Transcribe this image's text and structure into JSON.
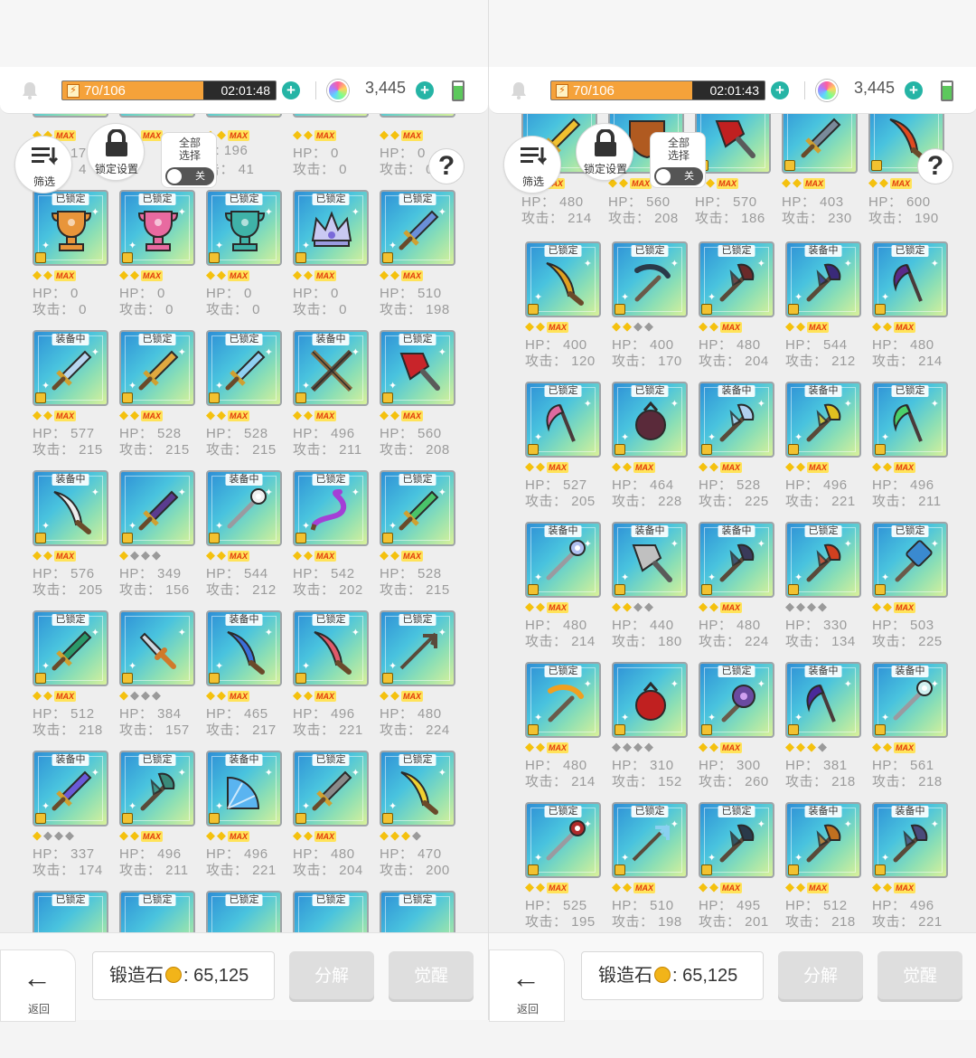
{
  "status": {
    "stamina_text": "70/106",
    "stamina_fraction": 0.66
  },
  "panels": [
    {
      "id": "left",
      "timer": "02:01:48",
      "gems": "3,445",
      "offset": 0,
      "partial_top": [
        {
          "hp": "17",
          "atk": "4"
        },
        {
          "hp": "",
          "atk": ""
        },
        {
          "hp": "196",
          "atk": "41",
          "hpPrefix": "P:",
          "atkPrefix": "击："
        },
        {
          "hp": "0",
          "atk": "0"
        },
        {
          "hp": "0",
          "atk": "0"
        }
      ]
    },
    {
      "id": "right",
      "timer": "02:01:43",
      "gems": "3,445",
      "offset": 0
    }
  ],
  "labels": {
    "hp": "HP：",
    "atk": "攻击：",
    "locked": "已锁定",
    "equipped": "装备中",
    "max": "MAX",
    "filter": "筛选",
    "lock_settings": "锁定设置",
    "select_all": "全部\n选择",
    "toggle_off": "关",
    "help": "?",
    "back": "返回",
    "stone_label": "锻造石",
    "stone_value": "65,125",
    "decompose": "分解",
    "awaken": "觉醒"
  },
  "left_items": [
    {
      "badge": "已锁定",
      "rank": "max",
      "hp": "0",
      "atk": "0",
      "color": "#e8953a",
      "shape": "trophy"
    },
    {
      "badge": "已锁定",
      "rank": "max",
      "hp": "0",
      "atk": "0",
      "color": "#e86aa0",
      "shape": "trophy"
    },
    {
      "badge": "已锁定",
      "rank": "max",
      "hp": "0",
      "atk": "0",
      "color": "#3fb2a8",
      "shape": "trophy"
    },
    {
      "badge": "已锁定",
      "rank": "max",
      "hp": "0",
      "atk": "0",
      "color": "#c9c9f2",
      "shape": "crown"
    },
    {
      "badge": "已锁定",
      "rank": "max",
      "hp": "510",
      "atk": "198",
      "color": "#6a8fd9",
      "shape": "sword"
    },
    {
      "badge": "装备中",
      "rank": "max",
      "hp": "577",
      "atk": "215",
      "color": "#b8d6f0",
      "shape": "sword"
    },
    {
      "badge": "已锁定",
      "rank": "max",
      "hp": "528",
      "atk": "215",
      "color": "#e0a940",
      "shape": "sword"
    },
    {
      "badge": "已锁定",
      "rank": "max",
      "hp": "528",
      "atk": "215",
      "color": "#8fd0f2",
      "shape": "sword"
    },
    {
      "badge": "装备中",
      "rank": "max",
      "hp": "496",
      "atk": "211",
      "color": "#8a6a3f",
      "shape": "crossed"
    },
    {
      "badge": "已锁定",
      "rank": "max",
      "hp": "560",
      "atk": "208",
      "color": "#c8242a",
      "shape": "cleaver"
    },
    {
      "badge": "装备中",
      "rank": "max",
      "hp": "576",
      "atk": "205",
      "color": "#ececec",
      "shape": "scimitar"
    },
    {
      "badge": "",
      "rank": "1g3s",
      "hp": "349",
      "atk": "156",
      "color": "#5a3c8f",
      "shape": "sword"
    },
    {
      "badge": "装备中",
      "rank": "max",
      "hp": "544",
      "atk": "212",
      "color": "#f0f0f0",
      "shape": "staff"
    },
    {
      "badge": "已锁定",
      "rank": "max",
      "hp": "542",
      "atk": "202",
      "color": "#a43fd6",
      "shape": "whip"
    },
    {
      "badge": "已锁定",
      "rank": "max",
      "hp": "528",
      "atk": "215",
      "color": "#49c46a",
      "shape": "sword"
    },
    {
      "badge": "已锁定",
      "rank": "max",
      "hp": "512",
      "atk": "218",
      "color": "#2a9a6a",
      "shape": "sword"
    },
    {
      "badge": "",
      "rank": "1g3s",
      "hp": "384",
      "atk": "157",
      "color": "#d07a2a",
      "shape": "dagger"
    },
    {
      "badge": "装备中",
      "rank": "max",
      "hp": "465",
      "atk": "217",
      "color": "#3a6fd9",
      "shape": "scimitar"
    },
    {
      "badge": "已锁定",
      "rank": "max",
      "hp": "496",
      "atk": "221",
      "color": "#e05a6a",
      "shape": "scimitar"
    },
    {
      "badge": "已锁定",
      "rank": "max",
      "hp": "480",
      "atk": "224",
      "color": "#5a4a3a",
      "shape": "trident"
    },
    {
      "badge": "装备中",
      "rank": "1g3s",
      "hp": "337",
      "atk": "174",
      "color": "#6a5ad9",
      "shape": "sword"
    },
    {
      "badge": "已锁定",
      "rank": "max",
      "hp": "496",
      "atk": "211",
      "color": "#3a8a7a",
      "shape": "axe"
    },
    {
      "badge": "装备中",
      "rank": "max",
      "hp": "496",
      "atk": "221",
      "color": "#5ab4f0",
      "shape": "fan"
    },
    {
      "badge": "已锁定",
      "rank": "max",
      "hp": "480",
      "atk": "204",
      "color": "#8a8a8a",
      "shape": "sword"
    },
    {
      "badge": "已锁定",
      "rank": "3g1s",
      "hp": "470",
      "atk": "200",
      "color": "#f0d030",
      "shape": "scimitar"
    }
  ],
  "left_bottom_badges": [
    "已锁定",
    "已锁定",
    "已锁定",
    "已锁定",
    "已锁定"
  ],
  "right_top_stats": [
    {
      "hp": "480",
      "atk": "214",
      "color": "#f0c030",
      "shape": "sword"
    },
    {
      "hp": "560",
      "atk": "208",
      "color": "#b05a20",
      "shape": "shield"
    },
    {
      "hp": "570",
      "atk": "186",
      "color": "#c02020",
      "shape": "cleaver"
    },
    {
      "hp": "403",
      "atk": "230",
      "color": "#7a8a9a",
      "shape": "sword"
    },
    {
      "hp": "600",
      "atk": "190",
      "color": "#e04a20",
      "shape": "scimitar"
    }
  ],
  "right_items": [
    {
      "badge": "已锁定",
      "rank": "max",
      "hp": "400",
      "atk": "120",
      "color": "#e0a020",
      "shape": "scimitar"
    },
    {
      "badge": "已锁定",
      "rank": "2g2s",
      "hp": "400",
      "atk": "170",
      "color": "#2a3a4a",
      "shape": "pick"
    },
    {
      "badge": "已锁定",
      "rank": "max",
      "hp": "480",
      "atk": "204",
      "color": "#6a2a2a",
      "shape": "axe"
    },
    {
      "badge": "装备中",
      "rank": "max",
      "hp": "544",
      "atk": "212",
      "color": "#3a2a7a",
      "shape": "axe"
    },
    {
      "badge": "已锁定",
      "rank": "max",
      "hp": "480",
      "atk": "214",
      "color": "#5a2a8a",
      "shape": "scythe"
    },
    {
      "badge": "已锁定",
      "rank": "max",
      "hp": "527",
      "atk": "205",
      "color": "#e06aa0",
      "shape": "scythe"
    },
    {
      "badge": "已锁定",
      "rank": "max",
      "hp": "464",
      "atk": "228",
      "color": "#5a2a3a",
      "shape": "bag"
    },
    {
      "badge": "装备中",
      "rank": "max",
      "hp": "528",
      "atk": "225",
      "color": "#b0d0f0",
      "shape": "axe"
    },
    {
      "badge": "装备中",
      "rank": "max",
      "hp": "496",
      "atk": "221",
      "color": "#e0c020",
      "shape": "axe"
    },
    {
      "badge": "已锁定",
      "rank": "max",
      "hp": "496",
      "atk": "211",
      "color": "#4ad06a",
      "shape": "scythe"
    },
    {
      "badge": "装备中",
      "rank": "max",
      "hp": "480",
      "atk": "214",
      "color": "#b0c0f0",
      "shape": "staff"
    },
    {
      "badge": "装备中",
      "rank": "2g2s",
      "hp": "440",
      "atk": "180",
      "color": "#c0c0c0",
      "shape": "cleaver"
    },
    {
      "badge": "装备中",
      "rank": "max",
      "hp": "480",
      "atk": "224",
      "color": "#3a3a5a",
      "shape": "axe"
    },
    {
      "badge": "已锁定",
      "rank": "max",
      "hp": "330",
      "atk": "134",
      "color": "#d04020",
      "shape": "axe",
      "rankOverride": "4s"
    },
    {
      "badge": "已锁定",
      "rank": "max",
      "hp": "503",
      "atk": "225",
      "color": "#3a8ad0",
      "shape": "hammer"
    },
    {
      "badge": "已锁定",
      "rank": "max",
      "hp": "480",
      "atk": "214",
      "color": "#f0a020",
      "shape": "pick"
    },
    {
      "badge": "",
      "rank": "4s",
      "hp": "310",
      "atk": "152",
      "color": "#c02020",
      "shape": "bag"
    },
    {
      "badge": "已锁定",
      "rank": "max",
      "hp": "300",
      "atk": "260",
      "color": "#6a4aa0",
      "shape": "mace"
    },
    {
      "badge": "装备中",
      "rank": "3g1s",
      "hp": "381",
      "atk": "218",
      "color": "#4a2a9a",
      "shape": "scythe"
    },
    {
      "badge": "装备中",
      "rank": "max",
      "hp": "561",
      "atk": "218",
      "color": "#d0f0f0",
      "shape": "staff"
    },
    {
      "badge": "已锁定",
      "rank": "max",
      "hp": "525",
      "atk": "195",
      "color": "#b02a2a",
      "shape": "staff"
    },
    {
      "badge": "已锁定",
      "rank": "max",
      "hp": "510",
      "atk": "198",
      "color": "#8ad0f0",
      "shape": "trident"
    },
    {
      "badge": "已锁定",
      "rank": "max",
      "hp": "495",
      "atk": "201",
      "color": "#2a3a4a",
      "shape": "axe"
    },
    {
      "badge": "装备中",
      "rank": "max",
      "hp": "512",
      "atk": "218",
      "color": "#c07020",
      "shape": "axe"
    },
    {
      "badge": "装备中",
      "rank": "max",
      "hp": "496",
      "atk": "221",
      "color": "#4a4a7a",
      "shape": "axe"
    }
  ]
}
